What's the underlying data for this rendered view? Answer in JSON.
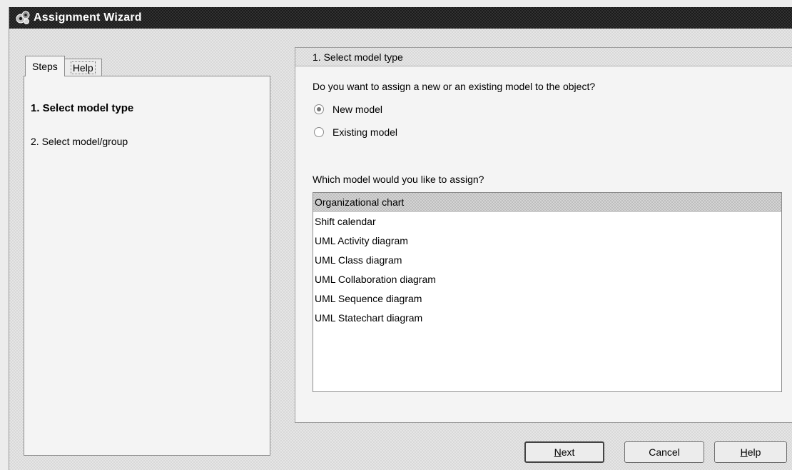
{
  "window": {
    "title": "Assignment Wizard",
    "icon": "gear-cluster-icon"
  },
  "left_panel": {
    "tabs": [
      {
        "label": "Steps",
        "active": true
      },
      {
        "label": "Help",
        "active": false
      }
    ],
    "steps": [
      {
        "label": "1. Select model type",
        "current": true
      },
      {
        "label": "2. Select model/group",
        "current": false
      }
    ]
  },
  "main": {
    "header": "1. Select model type",
    "question": "Do you want to assign a new or an existing model to the object?",
    "radio_options": [
      {
        "label": "New model",
        "checked": true
      },
      {
        "label": "Existing model",
        "checked": false
      }
    ],
    "list_prompt": "Which model would you like to assign?",
    "models": [
      "Organizational chart",
      "Shift calendar",
      "UML Activity diagram",
      "UML Class diagram",
      "UML Collaboration diagram",
      "UML Sequence diagram",
      "UML Statechart diagram"
    ],
    "selected_model": "Organizational chart"
  },
  "buttons": {
    "next": {
      "mnemonic": "N",
      "rest": "ext"
    },
    "cancel": "Cancel",
    "help": {
      "mnemonic": "H",
      "rest": "elp"
    }
  },
  "colors": {
    "titlebar": "#1b1b1b",
    "window_bg": "#e6e6e6",
    "selection": "#d4d4d4"
  }
}
